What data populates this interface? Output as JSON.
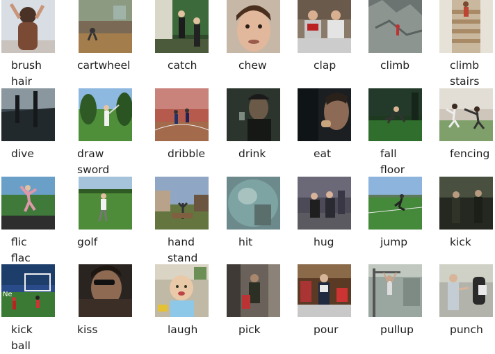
{
  "grid": {
    "items": [
      {
        "lines": [
          "brush",
          "hair"
        ],
        "scene": "person-brushing-hair"
      },
      {
        "lines": [
          "cartwheel"
        ],
        "scene": "gym-cartwheel"
      },
      {
        "lines": [
          "catch"
        ],
        "scene": "people-catching-ball"
      },
      {
        "lines": [
          "chew"
        ],
        "scene": "face-chewing"
      },
      {
        "lines": [
          "clap"
        ],
        "scene": "men-clapping"
      },
      {
        "lines": [
          "climb"
        ],
        "scene": "rock-climbing"
      },
      {
        "lines": [
          "climb",
          "stairs"
        ],
        "scene": "climbing-stairs"
      },
      {
        "lines": [
          "dive"
        ],
        "scene": "diving"
      },
      {
        "lines": [
          "draw",
          "sword"
        ],
        "scene": "drawing-sword-garden"
      },
      {
        "lines": [
          "dribble"
        ],
        "scene": "basketball-dribble"
      },
      {
        "lines": [
          "drink"
        ],
        "scene": "man-drinking"
      },
      {
        "lines": [
          "eat"
        ],
        "scene": "person-eating"
      },
      {
        "lines": [
          "fall",
          "floor"
        ],
        "scene": "falling-on-floor"
      },
      {
        "lines": [
          "fencing"
        ],
        "scene": "fencing-on-grass"
      },
      {
        "lines": [
          "flic",
          "flac"
        ],
        "scene": "gymnast-flic-flac"
      },
      {
        "lines": [
          "golf"
        ],
        "scene": "golfer-on-course"
      },
      {
        "lines": [
          "hand",
          "stand"
        ],
        "scene": "handstand-outdoors"
      },
      {
        "lines": [
          "hit"
        ],
        "scene": "blurry-hit"
      },
      {
        "lines": [
          "hug"
        ],
        "scene": "people-hugging"
      },
      {
        "lines": [
          "jump"
        ],
        "scene": "jump-on-field"
      },
      {
        "lines": [
          "kick"
        ],
        "scene": "kick-dark-room"
      },
      {
        "lines": [
          "kick",
          "ball"
        ],
        "scene": "soccer-kick-ball"
      },
      {
        "lines": [
          "kiss"
        ],
        "scene": "people-kissing"
      },
      {
        "lines": [
          "laugh"
        ],
        "scene": "baby-laughing"
      },
      {
        "lines": [
          "pick"
        ],
        "scene": "person-picking"
      },
      {
        "lines": [
          "pour"
        ],
        "scene": "man-pouring-drink"
      },
      {
        "lines": [
          "pullup"
        ],
        "scene": "pullup-bar"
      },
      {
        "lines": [
          "punch"
        ],
        "scene": "punching-bag"
      }
    ]
  },
  "colors": {
    "text": "#1e1e1e",
    "background": "#ffffff"
  }
}
